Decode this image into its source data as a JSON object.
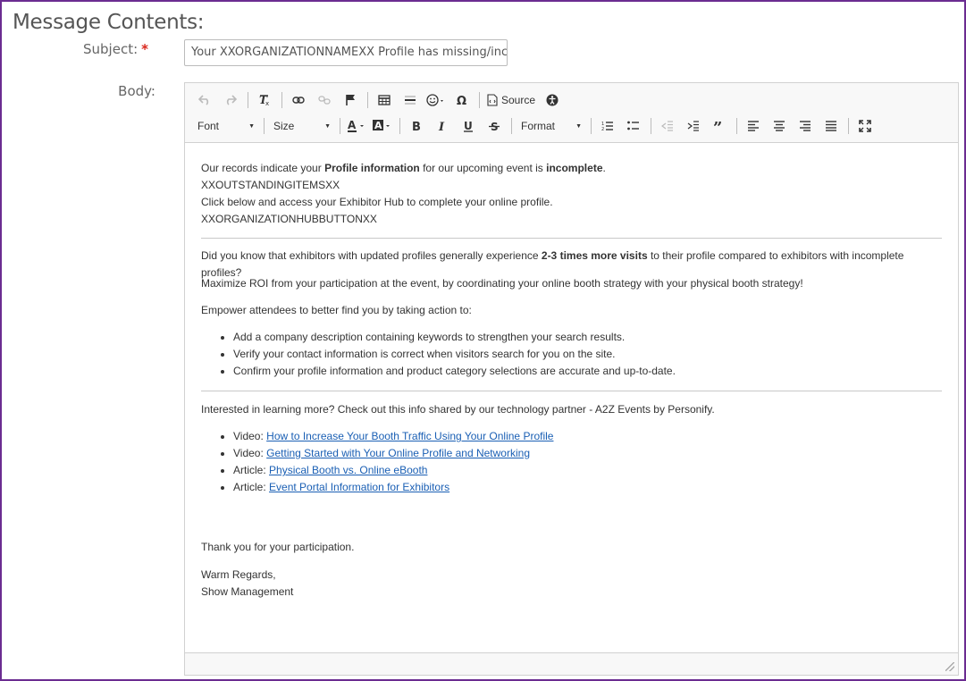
{
  "section_title": "Message Contents:",
  "subject": {
    "label": "Subject:",
    "required_marker": "*",
    "value": "Your XXORGANIZATIONNAMEXX Profile has missing/incomplete"
  },
  "body_label": "Body:",
  "toolbar": {
    "source_label": "Source",
    "font_label": "Font",
    "size_label": "Size",
    "format_label": "Format"
  },
  "content": {
    "intro": {
      "pre": "Our records indicate your ",
      "bold1": "Profile information",
      "mid": " for our upcoming event is ",
      "bold2": "incomplete",
      "end": "."
    },
    "outstanding": "XXOUTSTANDINGITEMSXX",
    "click_below": "Click below and access your Exhibitor Hub to complete your online profile.",
    "hub_button": "XXORGANIZATIONHUBBUTTONXX",
    "did_you_know": {
      "pre": "Did you know that exhibitors with updated profiles generally experience ",
      "bold": "2-3 times more visits",
      "post": " to their profile compared to exhibitors with incomplete profiles?"
    },
    "maximize": "Maximize ROI from your participation at the event, by coordinating your online booth strategy with your physical booth strategy!",
    "empower": "Empower attendees to better find you by taking action to:",
    "actions": [
      "Add a company description containing keywords to strengthen your search results.",
      "Verify your contact information is correct when visitors search for you on the site.",
      "Confirm your profile information and product category selections are accurate and up-to-date."
    ],
    "learn_more": "Interested in learning more? Check out this info shared by our technology partner - A2Z Events by Personify.",
    "resources": [
      {
        "prefix": "Video: ",
        "link": "How to Increase Your Booth Traffic Using Your Online Profile"
      },
      {
        "prefix": "Video: ",
        "link": "Getting Started with Your Online Profile and Networking"
      },
      {
        "prefix": "Article: ",
        "link": "Physical Booth vs. Online eBooth"
      },
      {
        "prefix": "Article: ",
        "link": "Event Portal Information for Exhibitors"
      }
    ],
    "thanks": "Thank you for your participation.",
    "regards": "Warm Regards,",
    "signature": "Show Management"
  },
  "colors": {
    "frame_border": "#6b2c91",
    "required": "#d9261c",
    "link": "#1a5fb4"
  }
}
